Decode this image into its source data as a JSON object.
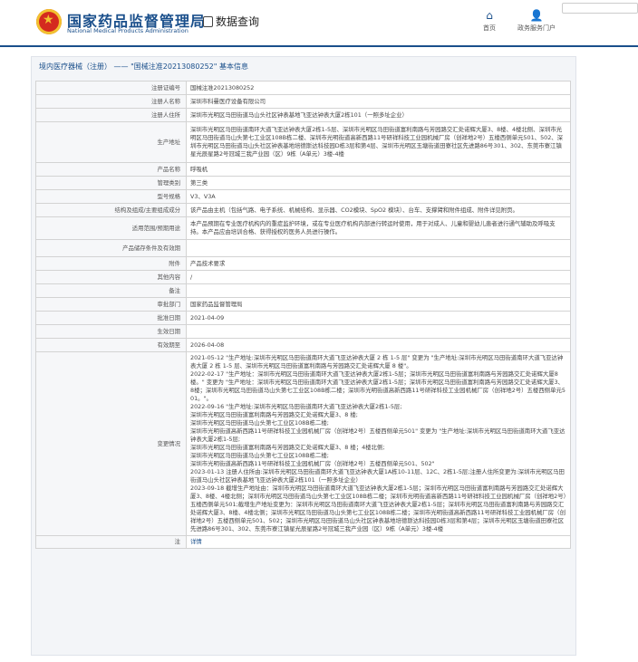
{
  "header": {
    "site_title": "国家药品监督管理局",
    "site_subtitle": "National Medical Products Administration",
    "data_query": "数据查询",
    "nav": [
      {
        "label": "首页",
        "icon": "home-icon"
      },
      {
        "label": "政务服务门户",
        "icon": "user-icon"
      }
    ]
  },
  "breadcrumb": {
    "prefix": "境内医疗器械（注册）",
    "separator": "——",
    "reg_no": "\"国械注准20213080252\"",
    "suffix": "基本信息"
  },
  "fields": [
    {
      "label": "注册证编号",
      "value": "国械注准20213080252"
    },
    {
      "label": "注册人名称",
      "value": "深圳市科曼医疗设备有限公司"
    },
    {
      "label": "注册人住所",
      "value": "深圳市光明区马田街道马山头社区钟表基地飞亚达钟表大厦2栋101（一照多址企业）"
    },
    {
      "label": "生产地址",
      "value": "深圳市光明区马田街道南环大道飞亚达钟表大厦2栋1-5层、深圳市光明区马田街道富利南路与芳园路交汇处诺辉大厦3、8楼、4楼北侧、深圳市光明区马田街道马山头第七工业区108B栋二楼、深圳市光明街道高新西路11号研祥科技工业园机械厂房（创祥地2号）五楼西侧单元501、502、深圳市光明区马田街道马山头社区钟表基地培德斯达科技园D栋3层和第4层、深圳市光明区玉塘街道田寮社区先进路86号301、302、东莞市寮江镇星光辰星路2号冠城三我产业园（区）9栋（A单元）3楼-4楼"
    },
    {
      "label": "产品名称",
      "value": "呼吸机"
    },
    {
      "label": "管理类别",
      "value": "第三类"
    },
    {
      "label": "型号规格",
      "value": "V3、V3A"
    },
    {
      "label": "结构及组成/主要组成成分",
      "value": "该产品由主机（包括气路、电子系统、机械结构、显示器、CO2模块、SpO2 模块）、台车、支撑臂和附件组成、附件详见附页。"
    },
    {
      "label": "适用范围/预期用途",
      "value": "本产品预期在专业医疗机构内的重症监护环境，或在专业医疗机构内部进行转运时使用，用于对成人、儿童和婴幼儿患者进行通气辅助及呼吸支持。本产品应由培训合格、获得授权的医务人员进行操作。"
    },
    {
      "label": "产品储存条件及有效期",
      "value": ""
    },
    {
      "label": "附件",
      "value": "产品技术要求"
    },
    {
      "label": "其他内容",
      "value": "/"
    },
    {
      "label": "备注",
      "value": ""
    },
    {
      "label": "审批部门",
      "value": "国家药品监督管理局"
    },
    {
      "label": "批准日期",
      "value": "2021-04-09"
    },
    {
      "label": "生效日期",
      "value": ""
    },
    {
      "label": "有效期至",
      "value": "2026-04-08"
    }
  ],
  "changes": {
    "label": "变更情况",
    "value": "2021-05-12 \"生产地址:深圳市光明区马田街道南环大道飞亚达钟表大厦 2 栋 1-5 层\" 变更为 \"生产地址:深圳市光明区马田街道南环大道飞亚达钟表大厦 2 栋 1-5 层、深圳市光明区马田街道富利南路与芳园路交汇处诺辉大厦 8 楼\"。\n2022-02-17 \"生产地址：深圳市光明区马田街道南环大道飞亚达钟表大厦2栋1-5层；深圳市光明区马田街道富利南路与芳园路交汇处诺辉大厦8楼。\" 变更为 \"生产地址：深圳市光明区马田街道南环大道飞亚达钟表大厦2栋1-5层；深圳市光明区马田街道富利南路与芳园路交汇处诺辉大厦3、8楼；深圳市光明区马田街道马山头第七工业区108B栋二楼；深圳市光明街道高新西路11号研祥科技工业园机械厂房（创祥地2号）五楼西侧单元501。\"。\n2022-09-16 \"生产地址:深圳市光明区马田街道南环大道飞亚达钟表大厦2栋1-5层;\n深圳市光明区马田街道富利南路与芳园路交汇处诺辉大厦3、8 楼;\n深圳市光明区马田街道马山头第七工业区108B栋二楼;\n深圳市光明街道高新西路11号研祥科技工业园机械厂房（创祥地2号）五楼西侧单元501\" 变更为 \"生产地址:深圳市光明区马田街道南环大道飞亚达钟表大厦2栋1-5层;\n深圳市光明区马田街道富利南路与芳园路交汇处诺辉大厦3、8 楼；4楼北侧;\n深圳市光明区马田街道马山头第七工业区108B栋二楼;\n深圳市光明街道高新西路11号研祥科技工业园机械厂房（创祥地2号）五楼西侧单元501、502\"\n2023-01-13 注册人住所由:深圳市光明区马田街道南环大道飞亚达钟表大厦1A栋10-11层、12C、2栋1-5层;注册人住所变更为:深圳市光明区马田街道马山头社区钟表基地飞亚达钟表大厦2栋101（一照多址企业）\n2023-09-18 截增生产地址由：深圳市光明区马田街道南环大道飞亚达钟表大厦2栋1-5层；深圳市光明区马田街道富利南路与芳园路交汇处诺辉大厦3、8楼、4楼北侧；深圳市光明区马田街道马山头第七工业区108B栋二楼；深圳市光明街道高新西路11号研祥科技工业园机械厂房（创祥地2号）五楼西侧单元501;截增生产地址变更为：深圳市光明区马田街道南环大道飞亚达钟表大厦2栋1-5层；深圳市光明区马田街道富利南路与芳园路交汇处诺辉大厦3、8楼、4楼北侧；深圳市光明区马田街道马山头第七工业区108B栋二楼；深圳市光明街道高新西路11号研祥科技工业园机械厂房（创祥地2号）五楼西侧单元501、502；深圳市光明区马田街道马山头社区钟表基地培德斯达科技园D栋3层和第4层；深圳市光明区玉塘街道田寮社区先进路86号301、302、东莞市寮江镇星光辰星路2号冠城三我产业园（区）9栋（A单元）3楼-4楼"
  },
  "notes": {
    "label": "注",
    "link": "详情"
  }
}
